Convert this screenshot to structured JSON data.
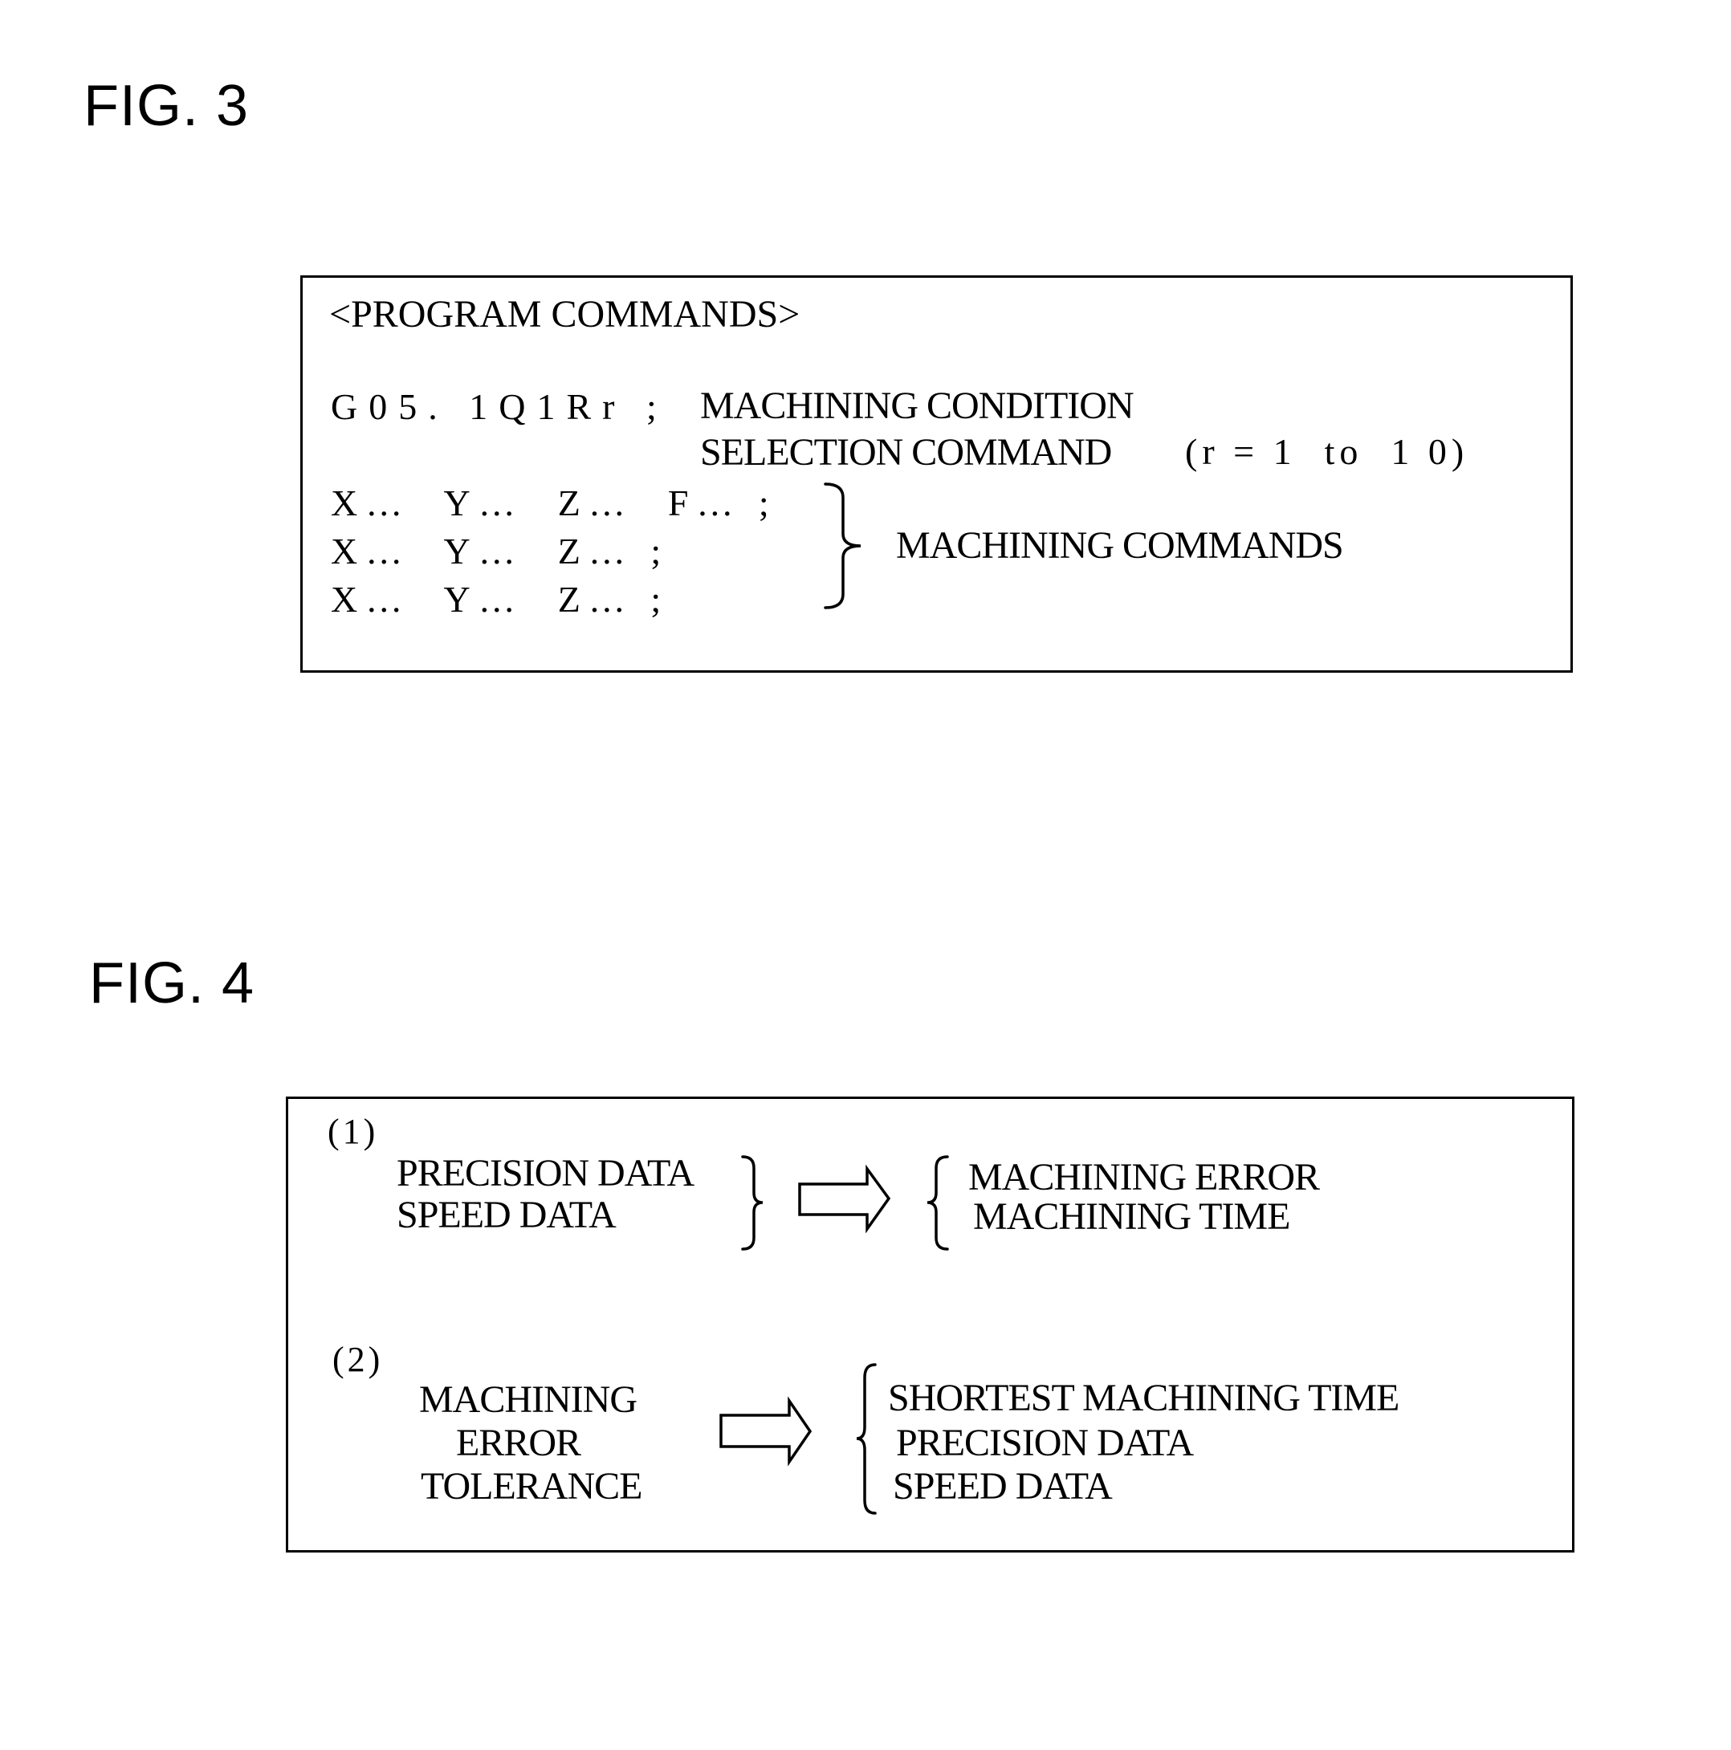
{
  "fig3": {
    "label": "FIG. 3",
    "heading": "<PROGRAM COMMANDS>",
    "selection_command": {
      "code": "G05. 1Q1Rr ;",
      "description_line1": "MACHINING CONDITION",
      "description_line2": "SELECTION COMMAND",
      "range_note": "(r = 1  to  1 0)"
    },
    "machining_lines": [
      "X…  Y…  Z…  F… ;",
      "X…  Y…  Z… ;",
      "X…  Y…  Z… ;"
    ],
    "brace_icon": "right-brace-icon",
    "machining_label": "MACHINING COMMANDS"
  },
  "fig4": {
    "label": "FIG. 4",
    "case1": {
      "marker": "(1)",
      "inputs": [
        "PRECISION DATA",
        "SPEED DATA"
      ],
      "arrow_icon": "right-arrow-icon",
      "outputs": [
        "MACHINING ERROR",
        "MACHINING TIME"
      ]
    },
    "case2": {
      "marker": "(2)",
      "inputs": [
        "MACHINING",
        "ERROR",
        "TOLERANCE"
      ],
      "arrow_icon": "right-arrow-icon",
      "outputs": [
        "SHORTEST MACHINING TIME",
        "PRECISION DATA",
        "SPEED DATA"
      ]
    }
  }
}
